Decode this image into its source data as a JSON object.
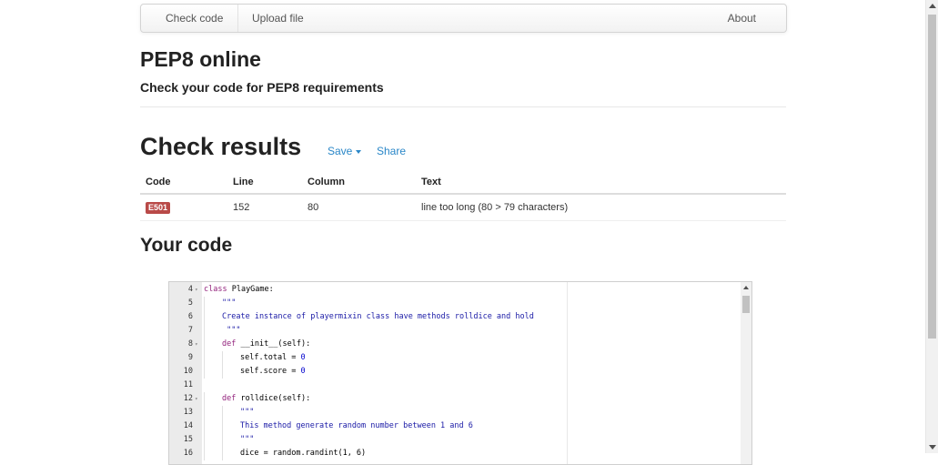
{
  "nav": {
    "check_code": "Check code",
    "upload_file": "Upload file",
    "about": "About"
  },
  "header": {
    "title": "PEP8 online",
    "subtitle": "Check your code for PEP8 requirements"
  },
  "results": {
    "title": "Check results",
    "save_label": "Save",
    "share_label": "Share",
    "columns": [
      "Code",
      "Line",
      "Column",
      "Text"
    ],
    "rows": [
      {
        "code": "E501",
        "line": "152",
        "column": "80",
        "text": "line too long (80 > 79 characters)"
      }
    ],
    "badge_color": "#b94a48"
  },
  "code_section": {
    "title": "Your code"
  },
  "editor": {
    "colors": {
      "keyword": "#93227c",
      "string": "#1a1aa6",
      "number": "#0000cd",
      "plain": "#000000"
    },
    "lines": [
      {
        "n": "4",
        "fold": true,
        "indent": 0,
        "tokens": [
          {
            "t": "class",
            "k": "keyword"
          },
          {
            "t": " PlayGame:",
            "k": "plain"
          }
        ]
      },
      {
        "n": "5",
        "fold": false,
        "indent": 1,
        "tokens": [
          {
            "t": "\"\"\"",
            "k": "string"
          }
        ]
      },
      {
        "n": "6",
        "fold": false,
        "indent": 1,
        "tokens": [
          {
            "t": "Create instance of playermixin class have methods rolldice and hold",
            "k": "string"
          }
        ]
      },
      {
        "n": "7",
        "fold": false,
        "indent": 1,
        "tokens": [
          {
            "t": " \"\"\"",
            "k": "string"
          }
        ]
      },
      {
        "n": "8",
        "fold": true,
        "indent": 1,
        "tokens": [
          {
            "t": "def",
            "k": "keyword"
          },
          {
            "t": " __init__(self):",
            "k": "plain"
          }
        ]
      },
      {
        "n": "9",
        "fold": false,
        "indent": 2,
        "tokens": [
          {
            "t": "self.total = ",
            "k": "plain"
          },
          {
            "t": "0",
            "k": "number"
          }
        ]
      },
      {
        "n": "10",
        "fold": false,
        "indent": 2,
        "tokens": [
          {
            "t": "self.score = ",
            "k": "plain"
          },
          {
            "t": "0",
            "k": "number"
          }
        ]
      },
      {
        "n": "11",
        "fold": false,
        "indent": 0,
        "tokens": []
      },
      {
        "n": "12",
        "fold": true,
        "indent": 1,
        "tokens": [
          {
            "t": "def",
            "k": "keyword"
          },
          {
            "t": " rolldice(self):",
            "k": "plain"
          }
        ]
      },
      {
        "n": "13",
        "fold": false,
        "indent": 2,
        "tokens": [
          {
            "t": "\"\"\"",
            "k": "string"
          }
        ]
      },
      {
        "n": "14",
        "fold": false,
        "indent": 2,
        "tokens": [
          {
            "t": "This method generate random number between 1 and 6",
            "k": "string"
          }
        ]
      },
      {
        "n": "15",
        "fold": false,
        "indent": 2,
        "tokens": [
          {
            "t": "\"\"\"",
            "k": "string"
          }
        ]
      },
      {
        "n": "16",
        "fold": false,
        "indent": 2,
        "tokens": [
          {
            "t": "dice = random.randint(1, 6)",
            "k": "plain"
          }
        ]
      }
    ]
  }
}
